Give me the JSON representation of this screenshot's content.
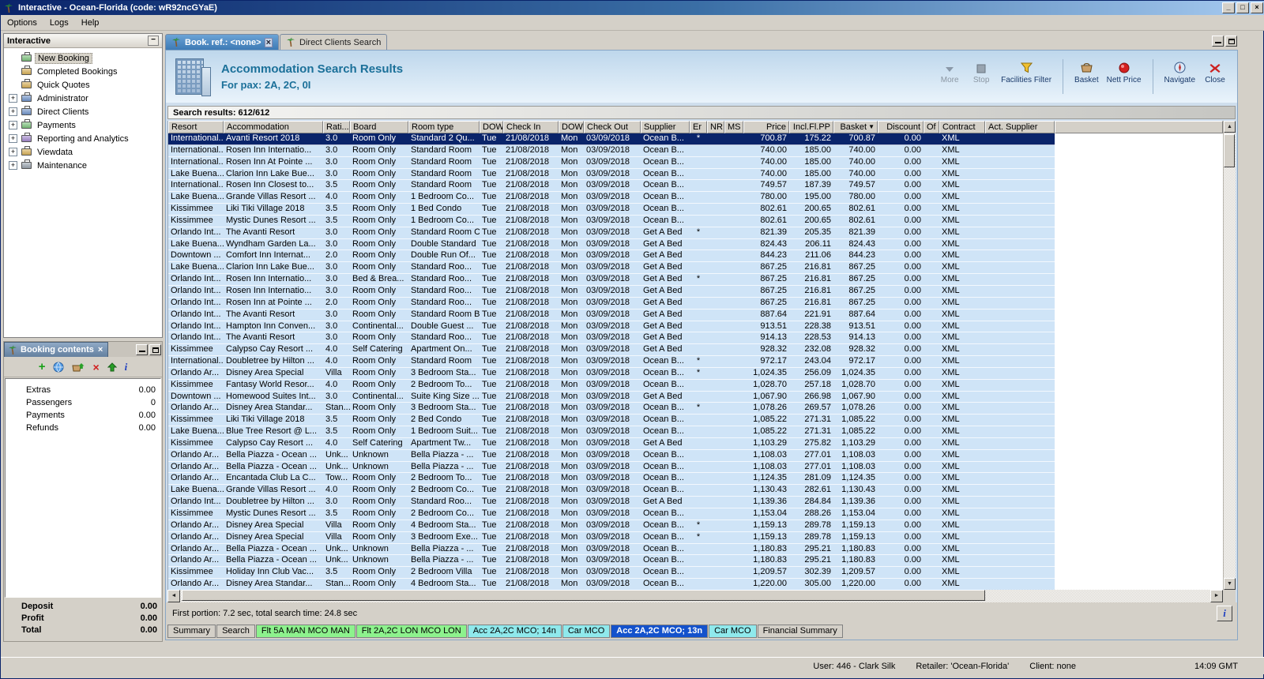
{
  "colors": {
    "titlebar": "#0a246a",
    "selection": "#0a246a",
    "header-text": "#1b7099",
    "row-bg": "#cfe4f7",
    "tab-green": "#8df28d",
    "tab-cyan": "#8fe9ec",
    "tab-blue": "#1452cc"
  },
  "window": {
    "title": "Interactive - Ocean-Florida (code: wR92ncGYaE)"
  },
  "menu": [
    "Options",
    "Logs",
    "Help"
  ],
  "sidebar": {
    "title": "Interactive",
    "items": [
      {
        "label": "New Booking",
        "icon": "new-booking-icon",
        "expandable": false,
        "selected": true
      },
      {
        "label": "Completed Bookings",
        "icon": "completed-bookings-icon",
        "expandable": false
      },
      {
        "label": "Quick Quotes",
        "icon": "quick-quotes-icon",
        "expandable": false
      },
      {
        "label": "Administrator",
        "icon": "administrator-icon",
        "expandable": true
      },
      {
        "label": "Direct Clients",
        "icon": "direct-clients-icon",
        "expandable": true
      },
      {
        "label": "Payments",
        "icon": "payments-icon",
        "expandable": true
      },
      {
        "label": "Reporting and Analytics",
        "icon": "reporting-icon",
        "expandable": true
      },
      {
        "label": "Viewdata",
        "icon": "viewdata-icon",
        "expandable": true
      },
      {
        "label": "Maintenance",
        "icon": "maintenance-icon",
        "expandable": true
      }
    ]
  },
  "booking_contents": {
    "title": "Booking contents",
    "toolbar": [
      {
        "name": "add-item-icon"
      },
      {
        "name": "globe-icon"
      },
      {
        "name": "add-to-basket-icon"
      },
      {
        "name": "delete-icon"
      },
      {
        "name": "move-up-icon"
      },
      {
        "name": "info-icon"
      }
    ],
    "items": [
      {
        "label": "Extras",
        "value": "0.00"
      },
      {
        "label": "Passengers",
        "value": "0"
      },
      {
        "label": "Payments",
        "value": "0.00"
      },
      {
        "label": "Refunds",
        "value": "0.00"
      }
    ],
    "totals": [
      {
        "label": "Deposit",
        "value": "0.00"
      },
      {
        "label": "Profit",
        "value": "0.00"
      },
      {
        "label": "Total",
        "value": "0.00"
      }
    ]
  },
  "doc_tabs": [
    {
      "label": "Book. ref.: <none>",
      "active": true,
      "closable": true
    },
    {
      "label": "Direct Clients Search",
      "active": false,
      "closable": false
    }
  ],
  "header": {
    "title": "Accommodation Search Results",
    "subtitle": "For pax: 2A, 2C, 0I",
    "toolbar": [
      {
        "label": "More",
        "icon": "more-icon",
        "disabled": true
      },
      {
        "label": "Stop",
        "icon": "stop-icon",
        "disabled": true
      },
      {
        "label": "Facilities Filter",
        "icon": "filter-icon",
        "disabled": false
      },
      {
        "label": "Basket",
        "icon": "basket-icon",
        "disabled": false,
        "sep_before": true
      },
      {
        "label": "Nett Price",
        "icon": "nett-price-icon",
        "disabled": false
      },
      {
        "label": "Navigate",
        "icon": "navigate-icon",
        "disabled": false,
        "sep_before": true
      },
      {
        "label": "Close",
        "icon": "close-icon",
        "disabled": false
      }
    ]
  },
  "results": {
    "summary": "Search results: 612/612",
    "sort_column": "Basket",
    "sort_indicator": "▼",
    "selected_row": 0,
    "footer": "First portion: 7.2 sec, total search time: 24.8 sec",
    "columns": [
      "Resort",
      "Accommodation",
      "Rati...",
      "Board",
      "Room type",
      "DOW",
      "Check In",
      "DOW",
      "Check Out",
      "Supplier",
      "Er",
      "NR",
      "MS",
      "Price",
      "Incl.Fl.PP",
      "Basket",
      "Discount",
      "Of",
      "Contract",
      "Act. Supplier"
    ],
    "rows": [
      [
        "International...",
        "Avanti Resort 2018",
        "3.0",
        "Room Only",
        "Standard 2 Qu...",
        "Tue",
        "21/08/2018",
        "Mon",
        "03/09/2018",
        "Ocean B...",
        "*",
        "",
        "",
        "700.87",
        "175.22",
        "700.87",
        "0.00",
        "",
        "XML",
        ""
      ],
      [
        "International...",
        "Rosen Inn Internatio...",
        "3.0",
        "Room Only",
        "Standard Room",
        "Tue",
        "21/08/2018",
        "Mon",
        "03/09/2018",
        "Ocean B...",
        "",
        "",
        "",
        "740.00",
        "185.00",
        "740.00",
        "0.00",
        "",
        "XML",
        ""
      ],
      [
        "International...",
        "Rosen Inn At Pointe ...",
        "3.0",
        "Room Only",
        "Standard Room",
        "Tue",
        "21/08/2018",
        "Mon",
        "03/09/2018",
        "Ocean B...",
        "",
        "",
        "",
        "740.00",
        "185.00",
        "740.00",
        "0.00",
        "",
        "XML",
        ""
      ],
      [
        "Lake Buena...",
        "Clarion Inn Lake Bue...",
        "3.0",
        "Room Only",
        "Standard Room",
        "Tue",
        "21/08/2018",
        "Mon",
        "03/09/2018",
        "Ocean B...",
        "",
        "",
        "",
        "740.00",
        "185.00",
        "740.00",
        "0.00",
        "",
        "XML",
        ""
      ],
      [
        "International...",
        "Rosen Inn Closest to...",
        "3.5",
        "Room Only",
        "Standard Room",
        "Tue",
        "21/08/2018",
        "Mon",
        "03/09/2018",
        "Ocean B...",
        "",
        "",
        "",
        "749.57",
        "187.39",
        "749.57",
        "0.00",
        "",
        "XML",
        ""
      ],
      [
        "Lake Buena...",
        "Grande Villas Resort ...",
        "4.0",
        "Room Only",
        "1 Bedroom Co...",
        "Tue",
        "21/08/2018",
        "Mon",
        "03/09/2018",
        "Ocean B...",
        "",
        "",
        "",
        "780.00",
        "195.00",
        "780.00",
        "0.00",
        "",
        "XML",
        ""
      ],
      [
        "Kissimmee",
        "Liki Tiki Village 2018",
        "3.5",
        "Room Only",
        "1 Bed Condo",
        "Tue",
        "21/08/2018",
        "Mon",
        "03/09/2018",
        "Ocean B...",
        "",
        "",
        "",
        "802.61",
        "200.65",
        "802.61",
        "0.00",
        "",
        "XML",
        ""
      ],
      [
        "Kissimmee",
        "Mystic Dunes Resort ...",
        "3.5",
        "Room Only",
        "1 Bedroom Co...",
        "Tue",
        "21/08/2018",
        "Mon",
        "03/09/2018",
        "Ocean B...",
        "",
        "",
        "",
        "802.61",
        "200.65",
        "802.61",
        "0.00",
        "",
        "XML",
        ""
      ],
      [
        "Orlando Int...",
        "The Avanti Resort",
        "3.0",
        "Room Only",
        "Standard Room C",
        "Tue",
        "21/08/2018",
        "Mon",
        "03/09/2018",
        "Get A Bed",
        "*",
        "",
        "",
        "821.39",
        "205.35",
        "821.39",
        "0.00",
        "",
        "XML",
        ""
      ],
      [
        "Lake Buena...",
        "Wyndham Garden La...",
        "3.0",
        "Room Only",
        "Double Standard",
        "Tue",
        "21/08/2018",
        "Mon",
        "03/09/2018",
        "Get A Bed",
        "",
        "",
        "",
        "824.43",
        "206.11",
        "824.43",
        "0.00",
        "",
        "XML",
        ""
      ],
      [
        "Downtown ...",
        "Comfort Inn Internat...",
        "2.0",
        "Room Only",
        "Double Run Of...",
        "Tue",
        "21/08/2018",
        "Mon",
        "03/09/2018",
        "Get A Bed",
        "",
        "",
        "",
        "844.23",
        "211.06",
        "844.23",
        "0.00",
        "",
        "XML",
        ""
      ],
      [
        "Lake Buena...",
        "Clarion Inn Lake Bue...",
        "3.0",
        "Room Only",
        "Standard Roo...",
        "Tue",
        "21/08/2018",
        "Mon",
        "03/09/2018",
        "Get A Bed",
        "",
        "",
        "",
        "867.25",
        "216.81",
        "867.25",
        "0.00",
        "",
        "XML",
        ""
      ],
      [
        "Orlando Int...",
        "Rosen Inn Internatio...",
        "3.0",
        "Bed & Brea...",
        "Standard Roo...",
        "Tue",
        "21/08/2018",
        "Mon",
        "03/09/2018",
        "Get A Bed",
        "*",
        "",
        "",
        "867.25",
        "216.81",
        "867.25",
        "0.00",
        "",
        "XML",
        ""
      ],
      [
        "Orlando Int...",
        "Rosen Inn Internatio...",
        "3.0",
        "Room Only",
        "Standard Roo...",
        "Tue",
        "21/08/2018",
        "Mon",
        "03/09/2018",
        "Get A Bed",
        "",
        "",
        "",
        "867.25",
        "216.81",
        "867.25",
        "0.00",
        "",
        "XML",
        ""
      ],
      [
        "Orlando Int...",
        "Rosen Inn at Pointe ...",
        "2.0",
        "Room Only",
        "Standard Roo...",
        "Tue",
        "21/08/2018",
        "Mon",
        "03/09/2018",
        "Get A Bed",
        "",
        "",
        "",
        "867.25",
        "216.81",
        "867.25",
        "0.00",
        "",
        "XML",
        ""
      ],
      [
        "Orlando Int...",
        "The Avanti Resort",
        "3.0",
        "Room Only",
        "Standard Room B",
        "Tue",
        "21/08/2018",
        "Mon",
        "03/09/2018",
        "Get A Bed",
        "",
        "",
        "",
        "887.64",
        "221.91",
        "887.64",
        "0.00",
        "",
        "XML",
        ""
      ],
      [
        "Orlando Int...",
        "Hampton Inn Conven...",
        "3.0",
        "Continental...",
        "Double Guest ...",
        "Tue",
        "21/08/2018",
        "Mon",
        "03/09/2018",
        "Get A Bed",
        "",
        "",
        "",
        "913.51",
        "228.38",
        "913.51",
        "0.00",
        "",
        "XML",
        ""
      ],
      [
        "Orlando Int...",
        "The Avanti Resort",
        "3.0",
        "Room Only",
        "Standard Roo...",
        "Tue",
        "21/08/2018",
        "Mon",
        "03/09/2018",
        "Get A Bed",
        "",
        "",
        "",
        "914.13",
        "228.53",
        "914.13",
        "0.00",
        "",
        "XML",
        ""
      ],
      [
        "Kissimmee",
        "Calypso Cay Resort ...",
        "4.0",
        "Self Catering",
        "Apartment On...",
        "Tue",
        "21/08/2018",
        "Mon",
        "03/09/2018",
        "Get A Bed",
        "",
        "",
        "",
        "928.32",
        "232.08",
        "928.32",
        "0.00",
        "",
        "XML",
        ""
      ],
      [
        "International...",
        "Doubletree by Hilton ...",
        "4.0",
        "Room Only",
        "Standard Room",
        "Tue",
        "21/08/2018",
        "Mon",
        "03/09/2018",
        "Ocean B...",
        "*",
        "",
        "",
        "972.17",
        "243.04",
        "972.17",
        "0.00",
        "",
        "XML",
        ""
      ],
      [
        "Orlando Ar...",
        "Disney Area Special",
        "Villa",
        "Room Only",
        "3 Bedroom Sta...",
        "Tue",
        "21/08/2018",
        "Mon",
        "03/09/2018",
        "Ocean B...",
        "*",
        "",
        "",
        "1,024.35",
        "256.09",
        "1,024.35",
        "0.00",
        "",
        "XML",
        ""
      ],
      [
        "Kissimmee",
        "Fantasy World Resor...",
        "4.0",
        "Room Only",
        "2 Bedroom To...",
        "Tue",
        "21/08/2018",
        "Mon",
        "03/09/2018",
        "Ocean B...",
        "",
        "",
        "",
        "1,028.70",
        "257.18",
        "1,028.70",
        "0.00",
        "",
        "XML",
        ""
      ],
      [
        "Downtown ...",
        "Homewood Suites Int...",
        "3.0",
        "Continental...",
        "Suite King Size ...",
        "Tue",
        "21/08/2018",
        "Mon",
        "03/09/2018",
        "Get A Bed",
        "",
        "",
        "",
        "1,067.90",
        "266.98",
        "1,067.90",
        "0.00",
        "",
        "XML",
        ""
      ],
      [
        "Orlando Ar...",
        "Disney Area Standar...",
        "Stan...",
        "Room Only",
        "3 Bedroom Sta...",
        "Tue",
        "21/08/2018",
        "Mon",
        "03/09/2018",
        "Ocean B...",
        "*",
        "",
        "",
        "1,078.26",
        "269.57",
        "1,078.26",
        "0.00",
        "",
        "XML",
        ""
      ],
      [
        "Kissimmee",
        "Liki Tiki Village 2018",
        "3.5",
        "Room Only",
        "2 Bed Condo",
        "Tue",
        "21/08/2018",
        "Mon",
        "03/09/2018",
        "Ocean B...",
        "",
        "",
        "",
        "1,085.22",
        "271.31",
        "1,085.22",
        "0.00",
        "",
        "XML",
        ""
      ],
      [
        "Lake Buena...",
        "Blue Tree Resort @ L...",
        "3.5",
        "Room Only",
        "1 Bedroom Suit...",
        "Tue",
        "21/08/2018",
        "Mon",
        "03/09/2018",
        "Ocean B...",
        "",
        "",
        "",
        "1,085.22",
        "271.31",
        "1,085.22",
        "0.00",
        "",
        "XML",
        ""
      ],
      [
        "Kissimmee",
        "Calypso Cay Resort ...",
        "4.0",
        "Self Catering",
        "Apartment Tw...",
        "Tue",
        "21/08/2018",
        "Mon",
        "03/09/2018",
        "Get A Bed",
        "",
        "",
        "",
        "1,103.29",
        "275.82",
        "1,103.29",
        "0.00",
        "",
        "XML",
        ""
      ],
      [
        "Orlando Ar...",
        "Bella Piazza - Ocean ...",
        "Unk...",
        "Unknown",
        "Bella Piazza - ...",
        "Tue",
        "21/08/2018",
        "Mon",
        "03/09/2018",
        "Ocean B...",
        "",
        "",
        "",
        "1,108.03",
        "277.01",
        "1,108.03",
        "0.00",
        "",
        "XML",
        ""
      ],
      [
        "Orlando Ar...",
        "Bella Piazza - Ocean ...",
        "Unk...",
        "Unknown",
        "Bella Piazza - ...",
        "Tue",
        "21/08/2018",
        "Mon",
        "03/09/2018",
        "Ocean B...",
        "",
        "",
        "",
        "1,108.03",
        "277.01",
        "1,108.03",
        "0.00",
        "",
        "XML",
        ""
      ],
      [
        "Orlando Ar...",
        "Encantada Club La C...",
        "Tow...",
        "Room Only",
        "2 Bedroom To...",
        "Tue",
        "21/08/2018",
        "Mon",
        "03/09/2018",
        "Ocean B...",
        "",
        "",
        "",
        "1,124.35",
        "281.09",
        "1,124.35",
        "0.00",
        "",
        "XML",
        ""
      ],
      [
        "Lake Buena...",
        "Grande Villas Resort ...",
        "4.0",
        "Room Only",
        "2 Bedroom Co...",
        "Tue",
        "21/08/2018",
        "Mon",
        "03/09/2018",
        "Ocean B...",
        "",
        "",
        "",
        "1,130.43",
        "282.61",
        "1,130.43",
        "0.00",
        "",
        "XML",
        ""
      ],
      [
        "Orlando Int...",
        "Doubletree by Hilton ...",
        "3.0",
        "Room Only",
        "Standard Roo...",
        "Tue",
        "21/08/2018",
        "Mon",
        "03/09/2018",
        "Get A Bed",
        "",
        "",
        "",
        "1,139.36",
        "284.84",
        "1,139.36",
        "0.00",
        "",
        "XML",
        ""
      ],
      [
        "Kissimmee",
        "Mystic Dunes Resort ...",
        "3.5",
        "Room Only",
        "2 Bedroom Co...",
        "Tue",
        "21/08/2018",
        "Mon",
        "03/09/2018",
        "Ocean B...",
        "",
        "",
        "",
        "1,153.04",
        "288.26",
        "1,153.04",
        "0.00",
        "",
        "XML",
        ""
      ],
      [
        "Orlando Ar...",
        "Disney Area Special",
        "Villa",
        "Room Only",
        "4 Bedroom Sta...",
        "Tue",
        "21/08/2018",
        "Mon",
        "03/09/2018",
        "Ocean B...",
        "*",
        "",
        "",
        "1,159.13",
        "289.78",
        "1,159.13",
        "0.00",
        "",
        "XML",
        ""
      ],
      [
        "Orlando Ar...",
        "Disney Area Special",
        "Villa",
        "Room Only",
        "3 Bedroom Exe...",
        "Tue",
        "21/08/2018",
        "Mon",
        "03/09/2018",
        "Ocean B...",
        "*",
        "",
        "",
        "1,159.13",
        "289.78",
        "1,159.13",
        "0.00",
        "",
        "XML",
        ""
      ],
      [
        "Orlando Ar...",
        "Bella Piazza - Ocean ...",
        "Unk...",
        "Unknown",
        "Bella Piazza - ...",
        "Tue",
        "21/08/2018",
        "Mon",
        "03/09/2018",
        "Ocean B...",
        "",
        "",
        "",
        "1,180.83",
        "295.21",
        "1,180.83",
        "0.00",
        "",
        "XML",
        ""
      ],
      [
        "Orlando Ar...",
        "Bella Piazza - Ocean ...",
        "Unk...",
        "Unknown",
        "Bella Piazza - ...",
        "Tue",
        "21/08/2018",
        "Mon",
        "03/09/2018",
        "Ocean B...",
        "",
        "",
        "",
        "1,180.83",
        "295.21",
        "1,180.83",
        "0.00",
        "",
        "XML",
        ""
      ],
      [
        "Kissimmee",
        "Holiday Inn Club Vac...",
        "3.5",
        "Room Only",
        "2 Bedroom Villa",
        "Tue",
        "21/08/2018",
        "Mon",
        "03/09/2018",
        "Ocean B...",
        "",
        "",
        "",
        "1,209.57",
        "302.39",
        "1,209.57",
        "0.00",
        "",
        "XML",
        ""
      ],
      [
        "Orlando Ar...",
        "Disney Area Standar...",
        "Stan...",
        "Room Only",
        "4 Bedroom Sta...",
        "Tue",
        "21/08/2018",
        "Mon",
        "03/09/2018",
        "Ocean B...",
        "",
        "",
        "",
        "1,220.00",
        "305.00",
        "1,220.00",
        "0.00",
        "",
        "XML",
        ""
      ]
    ]
  },
  "bottom_tabs": [
    {
      "label": "Summary",
      "style": "plain"
    },
    {
      "label": "Search",
      "style": "plain"
    },
    {
      "label": "Flt 5A MAN MCO MAN",
      "style": "green"
    },
    {
      "label": "Flt 2A,2C LON MCO LON",
      "style": "green"
    },
    {
      "label": "Acc 2A,2C MCO; 14n",
      "style": "cyan"
    },
    {
      "label": "Car MCO",
      "style": "cyan"
    },
    {
      "label": "Acc 2A,2C MCO; 13n",
      "style": "blue"
    },
    {
      "label": "Car MCO",
      "style": "cyan"
    },
    {
      "label": "Financial Summary",
      "style": "plain"
    }
  ],
  "status_bar": {
    "user": "User: 446 - Clark Silk",
    "retailer": "Retailer: 'Ocean-Florida'",
    "client": "Client: none",
    "time": "14:09 GMT"
  }
}
